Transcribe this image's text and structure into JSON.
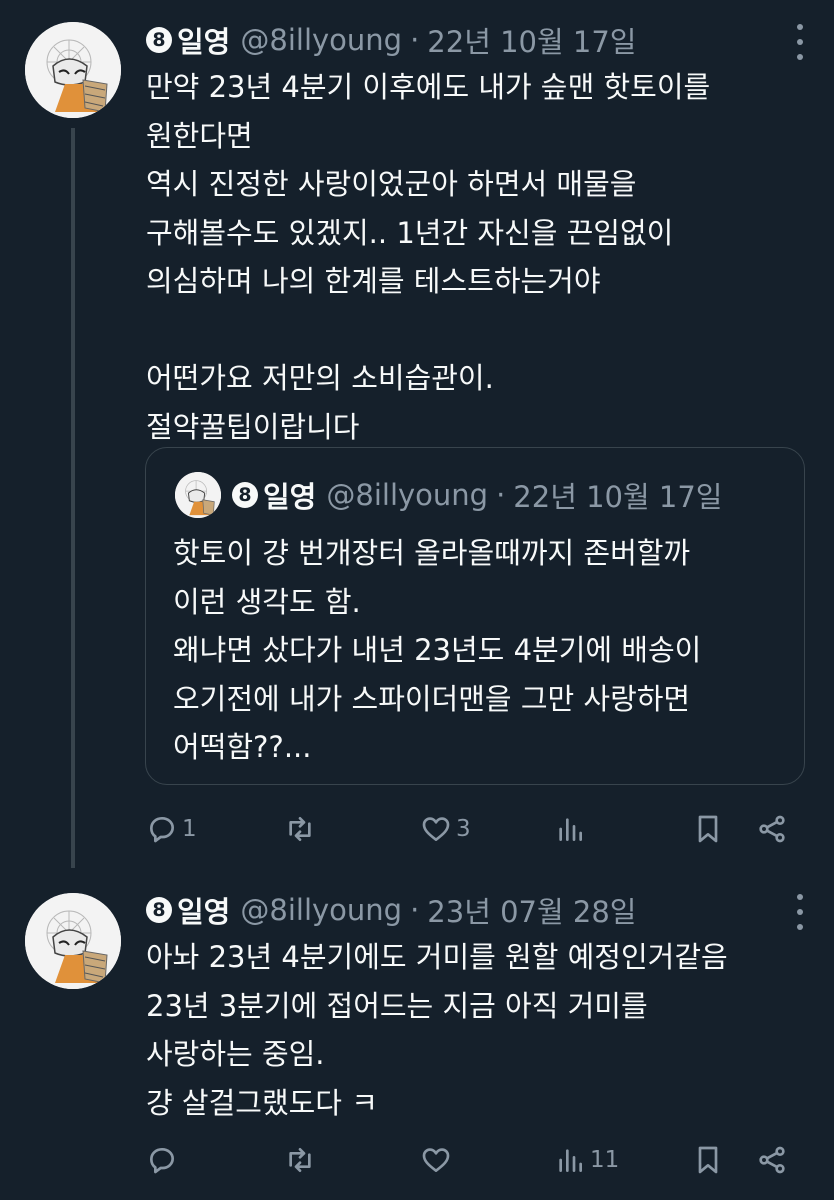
{
  "tweets": [
    {
      "display_name": "일영",
      "badge": "8",
      "handle": "@8illyoung",
      "separator": "·",
      "date": "22년 10월 17일",
      "lines": [
        "만약 23년 4분기 이후에도 내가 슾맨 핫토이를",
        "원한다면",
        "역시 진정한 사랑이었군아 하면서 매물을",
        "구해볼수도 있겠지.. 1년간 자신을 끈임없이",
        "의심하며 나의 한계를 테스트하는거야",
        "",
        "어떤가요 저만의 소비습관이.",
        "절약꿀팁이랍니다"
      ],
      "quote": {
        "display_name": "일영",
        "badge": "8",
        "handle": "@8illyoung",
        "separator": "·",
        "date": "22년 10월 17일",
        "lines": [
          "핫토이 걍 번개장터 올라올때까지 존버할까",
          "이런 생각도 함.",
          "왜냐면 샀다가 내년 23년도 4분기에 배송이",
          "오기전에 내가 스파이더맨을 그만 사랑하면",
          "어떡함??..."
        ]
      },
      "actions": {
        "reply_count": "1",
        "retweet_count": "",
        "like_count": "3",
        "views_count": ""
      }
    },
    {
      "display_name": "일영",
      "badge": "8",
      "handle": "@8illyoung",
      "separator": "·",
      "date": "23년 07월 28일",
      "lines": [
        "아놔 23년 4분기에도 거미를 원할 예정인거같음",
        "23년 3분기에 접어드는 지금 아직 거미를",
        "사랑하는 중임.",
        "걍 살걸그랬도다 ㅋ"
      ],
      "actions": {
        "reply_count": "",
        "retweet_count": "",
        "like_count": "",
        "views_count": "11"
      }
    }
  ],
  "icons": {
    "reply": "reply-icon",
    "retweet": "retweet-icon",
    "like": "heart-icon",
    "views": "views-icon",
    "bookmark": "bookmark-icon",
    "share": "share-icon",
    "more": "more-icon"
  },
  "colors": {
    "background": "#15202b",
    "text": "#f7f9f9",
    "secondary": "#8b98a5",
    "border": "#38444d"
  }
}
